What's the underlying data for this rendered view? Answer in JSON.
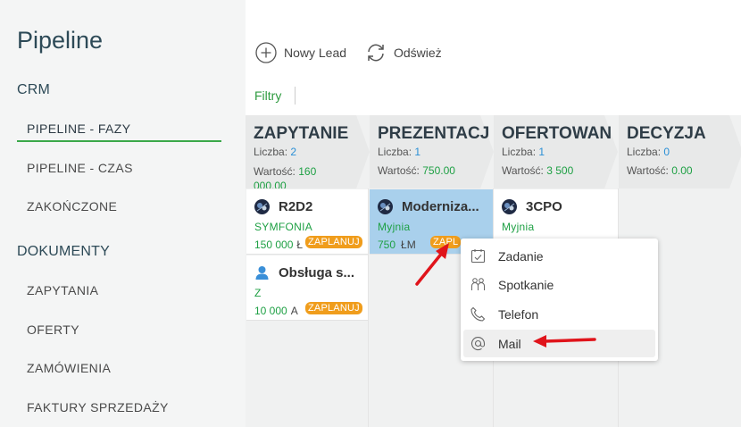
{
  "app": {
    "title": "Pipeline"
  },
  "sidebar": {
    "sections": [
      {
        "title": "CRM"
      },
      {
        "title": "DOKUMENTY"
      }
    ],
    "crm_items": [
      {
        "label": "PIPELINE - FAZY",
        "active": true
      },
      {
        "label": "PIPELINE - CZAS"
      },
      {
        "label": "ZAKOŃCZONE"
      }
    ],
    "doc_items": [
      {
        "label": "ZAPYTANIA"
      },
      {
        "label": "OFERTY"
      },
      {
        "label": "ZAMÓWIENIA"
      },
      {
        "label": "FAKTURY SPRZEDAŻY"
      }
    ]
  },
  "toolbar": {
    "new_lead": "Nowy Lead",
    "refresh": "Odśwież",
    "filters": "Filtry"
  },
  "stages": [
    {
      "name": "ZAPYTANIE",
      "count_label": "Liczba:",
      "count": "2",
      "value_label": "Wartość:",
      "value": "160 000.00"
    },
    {
      "name": "PREZENTACJA",
      "count_label": "Liczba:",
      "count": "1",
      "value_label": "Wartość:",
      "value": "750.00"
    },
    {
      "name": "OFERTOWANIE",
      "count_label": "Liczba:",
      "count": "1",
      "value_label": "Wartość:",
      "value": "3 500"
    },
    {
      "name": "DECYZJA",
      "count_label": "Liczba:",
      "count": "0",
      "value_label": "Wartość:",
      "value": "0.00"
    }
  ],
  "cards": [
    {
      "title": "R2D2",
      "company": "SYMFONIA",
      "value": "150 000",
      "currency": "Ł",
      "badge": "ZAPLANUJ",
      "avatar": "photo"
    },
    {
      "title": "Obsługa s...",
      "company": "Z",
      "value": "10 000",
      "currency": "A",
      "badge": "ZAPLANUJ",
      "avatar": "person-icon"
    },
    {
      "title": "Moderniza...",
      "company": "Myjnia",
      "value": "750",
      "currency": "ŁM",
      "badge": "ZAPL",
      "avatar": "photo",
      "selected": true
    },
    {
      "title": "3CPO",
      "company": "Myjnia",
      "value": "",
      "currency": "",
      "badge": "",
      "avatar": "photo"
    }
  ],
  "context_menu": {
    "items": [
      {
        "label": "Zadanie",
        "icon": "calendar-check-icon"
      },
      {
        "label": "Spotkanie",
        "icon": "people-icon"
      },
      {
        "label": "Telefon",
        "icon": "phone-icon"
      },
      {
        "label": "Mail",
        "icon": "at-icon",
        "hover": true
      }
    ]
  },
  "colors": {
    "accent_green": "#1ea044",
    "link_blue": "#2a8fd6",
    "badge_orange": "#f09d1c",
    "selected_card": "#a9d0ec",
    "annotation_red": "#e0141b"
  }
}
